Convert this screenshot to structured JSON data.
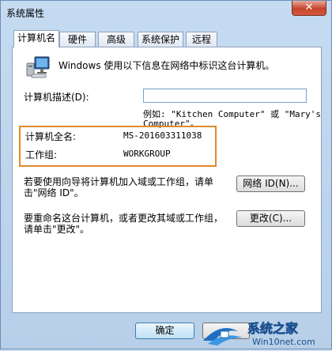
{
  "window": {
    "title": "系统属性",
    "close_label": "✕"
  },
  "tabs": [
    {
      "label": "计算机名",
      "active": true
    },
    {
      "label": "硬件",
      "active": false
    },
    {
      "label": "高级",
      "active": false
    },
    {
      "label": "系统保护",
      "active": false
    },
    {
      "label": "远程",
      "active": false
    }
  ],
  "computer_name_tab": {
    "intro_text": "Windows 使用以下信息在网络中标识这台计算机。",
    "description_label": "计算机描述(D):",
    "description_value": "",
    "example_line1": "例如: \"Kitchen Computer\" 或 \"Mary's",
    "example_line2": "Computer\"。",
    "full_name_label": "计算机全名:",
    "full_name_value": "MS-201603311038",
    "workgroup_label": "工作组:",
    "workgroup_value": "WORKGROUP",
    "network_id_text_line1": "若要使用向导将计算机加入域或工作组，请单",
    "network_id_text_line2": "击\"网络 ID\"。",
    "network_id_button": "网络 ID(N)...",
    "rename_text_line1": "要重命名这台计算机，或者更改其域或工作组，",
    "rename_text_line2": "请单击\"更改\"。",
    "change_button": "更改(C)..."
  },
  "footer": {
    "ok_button": "确定"
  },
  "watermark": {
    "brand": "系统之家",
    "url": "Win10net.com"
  },
  "colors": {
    "highlight_border": "#e08a2b",
    "title_bar": "#c5dbf1",
    "close_button": "#c7452c"
  }
}
